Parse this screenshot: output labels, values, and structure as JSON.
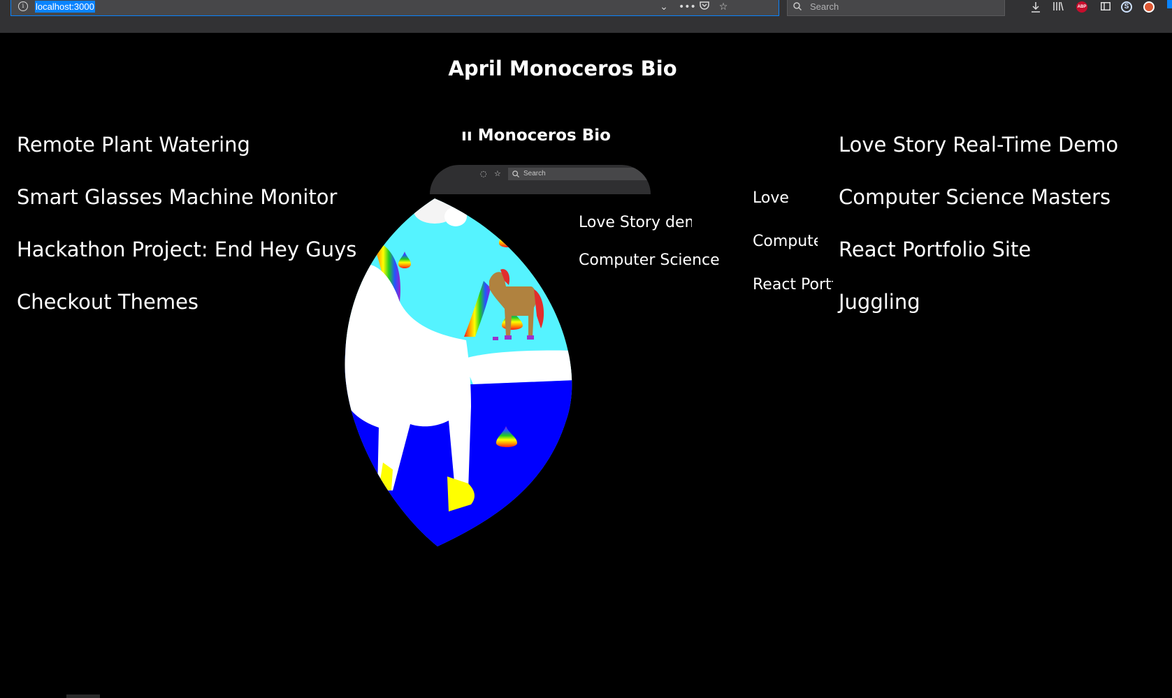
{
  "browser": {
    "url": "localhost:3000",
    "search_placeholder": "Search",
    "abp_label": "ABP",
    "s_label": "S"
  },
  "page": {
    "title": "April Monoceros Bio",
    "left_links": [
      "Remote Plant Watering",
      "Smart Glasses Machine Monitor",
      "Hackathon Project: End Hey Guys",
      "Checkout Themes"
    ],
    "right_links": [
      "Love Story Real-Time Demo",
      "Computer Science Masters",
      "React Portfolio Site",
      "Juggling"
    ]
  },
  "mirror": {
    "title": "ıı Monoceros Bio",
    "search_placeholder": "Search",
    "links": [
      "Love Story demo",
      "Computer Science Masters",
      "Love Story",
      "Computer Science",
      "React Portfolio"
    ]
  },
  "colors": {
    "background": "#000000",
    "text": "#ffffff",
    "sky": "#55f3ff",
    "water": "#0000ff",
    "unicorn_body": "#ffffff",
    "hooves": "#ffff00",
    "horse": "#b0823f"
  }
}
